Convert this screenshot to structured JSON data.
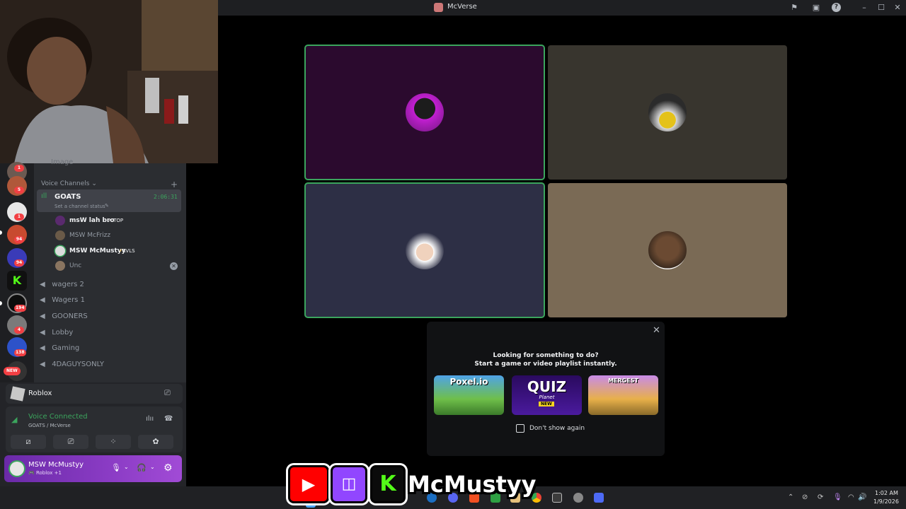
{
  "window": {
    "title": "McVerse"
  },
  "channels": {
    "partial_top": "Image",
    "voice_header": "Voice Channels",
    "active": {
      "name": "GOATS",
      "status": "Set a channel status",
      "timer": "2:06:31"
    },
    "members": [
      {
        "name": "msW lah bro",
        "tag": "TOP"
      },
      {
        "name": "MSW McFrizz",
        "tag": ""
      },
      {
        "name": "MSW McMustyy",
        "tag": "RVLS"
      },
      {
        "name": "Unc",
        "tag": ""
      }
    ],
    "list": [
      "wagers 2",
      "Wagers 1",
      "GOONERS",
      "Lobby",
      "Gaming",
      "4DAGUYSONLY"
    ]
  },
  "servers": {
    "badges": [
      "1",
      "5",
      "1",
      "94",
      "94",
      "194",
      "4",
      "138"
    ],
    "new_label": "NEW"
  },
  "activity_app": {
    "name": "Roblox"
  },
  "voice": {
    "status": "Voice Connected",
    "location": "GOATS / McVerse"
  },
  "user": {
    "name": "MSW McMustyy",
    "activity": "Roblox +1"
  },
  "popup": {
    "line1": "Looking for something to do?",
    "line2": "Start a game or video playlist instantly.",
    "games": [
      "Poxel.io",
      "QUIZ",
      "MERGEST"
    ],
    "quiz_sub": "Planet",
    "quiz_new": "NEW",
    "checkbox_label": "Don't show again"
  },
  "overlay": {
    "handle": "McMustyy"
  },
  "taskbar": {
    "time": "1:02 AM",
    "date": "1/9/2026"
  },
  "colors": {
    "speaking": "#3ba55d",
    "tile1": "#2b0a2e",
    "tile2": "#38352e",
    "tile3": "#2d2f45",
    "tile4": "#7a6a55"
  }
}
